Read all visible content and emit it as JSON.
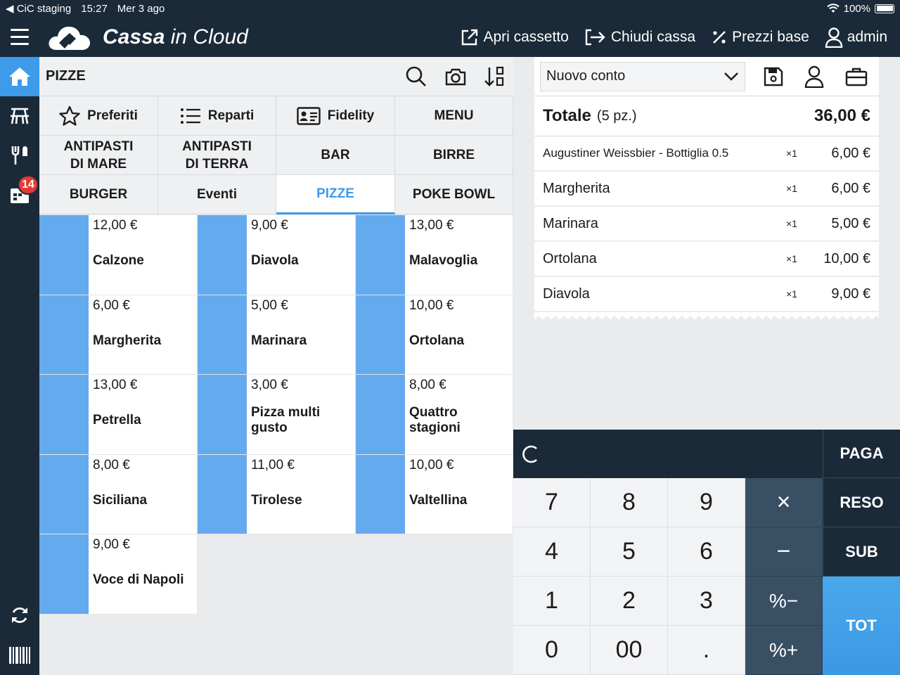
{
  "status": {
    "back_app": "CiC staging",
    "time": "15:27",
    "date": "Mer 3 ago",
    "battery": "100%"
  },
  "header": {
    "brand_bold": "Cassa",
    "brand_light": " in Cloud",
    "actions": {
      "open_drawer": "Apri cassetto",
      "close_register": "Chiudi cassa",
      "base_prices": "Prezzi base",
      "user": "admin"
    }
  },
  "sidebar": {
    "badge_count": "14"
  },
  "left": {
    "title": "PIZZE",
    "categories": [
      {
        "label": "Preferiti"
      },
      {
        "label": "Reparti"
      },
      {
        "label": "Fidelity"
      },
      {
        "label": "MENU"
      },
      {
        "label": "ANTIPASTI DI MARE"
      },
      {
        "label": "ANTIPASTI DI TERRA"
      },
      {
        "label": "BAR"
      },
      {
        "label": "BIRRE"
      },
      {
        "label": "BURGER"
      },
      {
        "label": "Eventi"
      },
      {
        "label": "PIZZE"
      },
      {
        "label": "POKE BOWL"
      }
    ],
    "products": [
      {
        "price": "12,00 €",
        "name": "Calzone"
      },
      {
        "price": "9,00 €",
        "name": "Diavola"
      },
      {
        "price": "13,00 €",
        "name": "Malavoglia"
      },
      {
        "price": "6,00 €",
        "name": "Margherita"
      },
      {
        "price": "5,00 €",
        "name": "Marinara"
      },
      {
        "price": "10,00 €",
        "name": "Ortolana"
      },
      {
        "price": "13,00 €",
        "name": "Petrella"
      },
      {
        "price": "3,00 €",
        "name": "Pizza multi gusto"
      },
      {
        "price": "8,00 €",
        "name": "Quattro stagioni"
      },
      {
        "price": "8,00 €",
        "name": "Siciliana"
      },
      {
        "price": "11,00 €",
        "name": "Tirolese"
      },
      {
        "price": "10,00 €",
        "name": "Valtellina"
      },
      {
        "price": "9,00 €",
        "name": "Voce di Napoli"
      }
    ]
  },
  "receipt": {
    "account": "Nuovo conto",
    "total_label": "Totale",
    "total_count": "(5 pz.)",
    "total_amount": "36,00 €",
    "lines": [
      {
        "name": "Augustiner Weissbier - Bottiglia 0.5",
        "qty": "×1",
        "price": "6,00 €"
      },
      {
        "name": "Margherita",
        "qty": "×1",
        "price": "6,00 €"
      },
      {
        "name": "Marinara",
        "qty": "×1",
        "price": "5,00 €"
      },
      {
        "name": "Ortolana",
        "qty": "×1",
        "price": "10,00 €"
      },
      {
        "name": "Diavola",
        "qty": "×1",
        "price": "9,00 €"
      }
    ]
  },
  "keypad": {
    "keys": [
      "7",
      "8",
      "9",
      "×",
      "4",
      "5",
      "6",
      "−",
      "1",
      "2",
      "3",
      "%−",
      "0",
      "00",
      ".",
      "%+"
    ],
    "pay": "PAGA",
    "refund": "RESO",
    "subtotal": "SUB",
    "total": "TOT"
  },
  "colors": {
    "accent": "#3d9be9",
    "dark": "#1b2a38",
    "product_swatch": "#64aaee"
  }
}
